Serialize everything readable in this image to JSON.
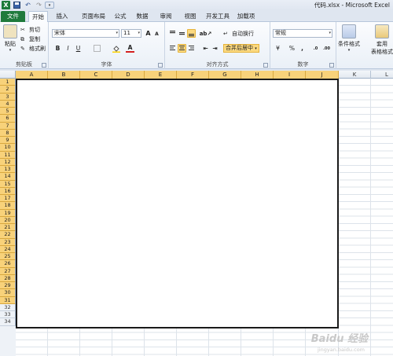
{
  "window": {
    "title": "代码.xlsx - Microsoft Excel"
  },
  "quick_access": {
    "customize": "▾"
  },
  "tabs": [
    {
      "label": "文件",
      "kind": "file"
    },
    {
      "label": "开始",
      "kind": "active"
    },
    {
      "label": "插入"
    },
    {
      "label": "页面布局"
    },
    {
      "label": "公式"
    },
    {
      "label": "数据"
    },
    {
      "label": "审阅"
    },
    {
      "label": "视图"
    },
    {
      "label": "开发工具"
    },
    {
      "label": "加载项"
    }
  ],
  "ribbon": {
    "clipboard": {
      "label": "剪贴板",
      "paste": "粘贴",
      "cut": "剪切",
      "copy": "复制",
      "format_painter": "格式刷"
    },
    "font": {
      "label": "字体",
      "font_name": "宋体",
      "font_size": "11",
      "grow": "A",
      "shrink": "A",
      "bold": "B",
      "italic": "I",
      "underline": "U",
      "font_color": "A",
      "fill_color_icon": "paint-bucket-icon"
    },
    "alignment": {
      "label": "对齐方式",
      "wrap_text": "自动换行",
      "merge_center": "合并后居中"
    },
    "number": {
      "label": "数字",
      "format": "常规",
      "currency": "¥",
      "percent": "%",
      "comma": ",",
      "inc_decimal": ".0",
      "dec_decimal": ".00"
    },
    "styles": {
      "conditional": "条件格式",
      "table": "套用",
      "table_sub": "表格格式"
    }
  },
  "sheet": {
    "columns": [
      "A",
      "B",
      "C",
      "D",
      "E",
      "F",
      "G",
      "H",
      "I",
      "J",
      "K",
      "L"
    ],
    "selected_columns": [
      "A",
      "B",
      "C",
      "D",
      "E",
      "F",
      "G",
      "H",
      "I",
      "J"
    ],
    "rows": [
      "1",
      "2",
      "3",
      "4",
      "5",
      "6",
      "7",
      "8",
      "9",
      "10",
      "11",
      "12",
      "13",
      "14",
      "15",
      "16",
      "17",
      "18",
      "19",
      "20",
      "21",
      "22",
      "23",
      "24",
      "25",
      "26",
      "27",
      "28",
      "29",
      "30",
      "31",
      "32",
      "33",
      "34"
    ],
    "selected_rows_through": 31,
    "selection_range": "A1:J31"
  },
  "watermark": {
    "text": "Baidu 经验",
    "sub": "jingyan.baidu.com"
  },
  "colors": {
    "file_tab": "#1f7a3c",
    "highlight": "#f8d27a",
    "selection_border": "#1a1a1a"
  }
}
